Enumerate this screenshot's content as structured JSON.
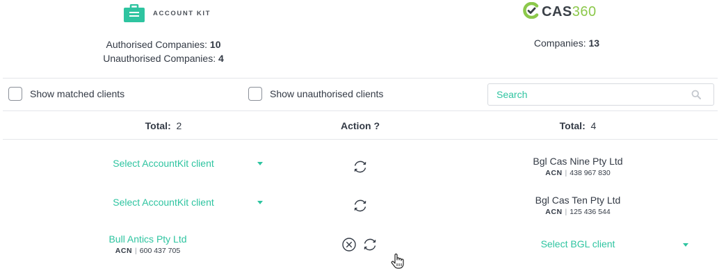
{
  "accountkit": {
    "logo_text": "ACCOUNT KIT",
    "authorised_label": "Authorised Companies:",
    "authorised_count": "10",
    "unauthorised_label": "Unauthorised Companies:",
    "unauthorised_count": "4"
  },
  "cas360": {
    "logo_text": "CAS",
    "logo_num": "360",
    "companies_label": "Companies:",
    "companies_count": "13"
  },
  "filters": {
    "show_matched": "Show matched clients",
    "show_unauthorised": "Show unauthorised clients",
    "search_placeholder": "Search"
  },
  "columns": {
    "left_total_label": "Total:",
    "left_total_value": "2",
    "action_label": "Action ?",
    "right_total_label": "Total:",
    "right_total_value": "4"
  },
  "rows": [
    {
      "left_select": "Select AccountKit client",
      "right_name": "Bgl Cas Nine Pty Ltd",
      "right_acn_label": "ACN",
      "right_acn": "438 967 830"
    },
    {
      "left_select": "Select AccountKit client",
      "right_name": "Bgl Cas Ten Pty Ltd",
      "right_acn_label": "ACN",
      "right_acn": "125 436 544"
    },
    {
      "left_name": "Bull Antics Pty Ltd",
      "left_acn_label": "ACN",
      "left_acn": "600 437 705",
      "right_select": "Select BGL client"
    }
  ],
  "colors": {
    "accent": "#2ec4a0",
    "text": "#333a45",
    "cas_green": "#8cc84b"
  },
  "icons": [
    "briefcase-icon",
    "cas360-logo-icon",
    "search-icon",
    "sync-icon",
    "unlink-icon",
    "caret-down-icon",
    "hand-cursor-icon"
  ]
}
